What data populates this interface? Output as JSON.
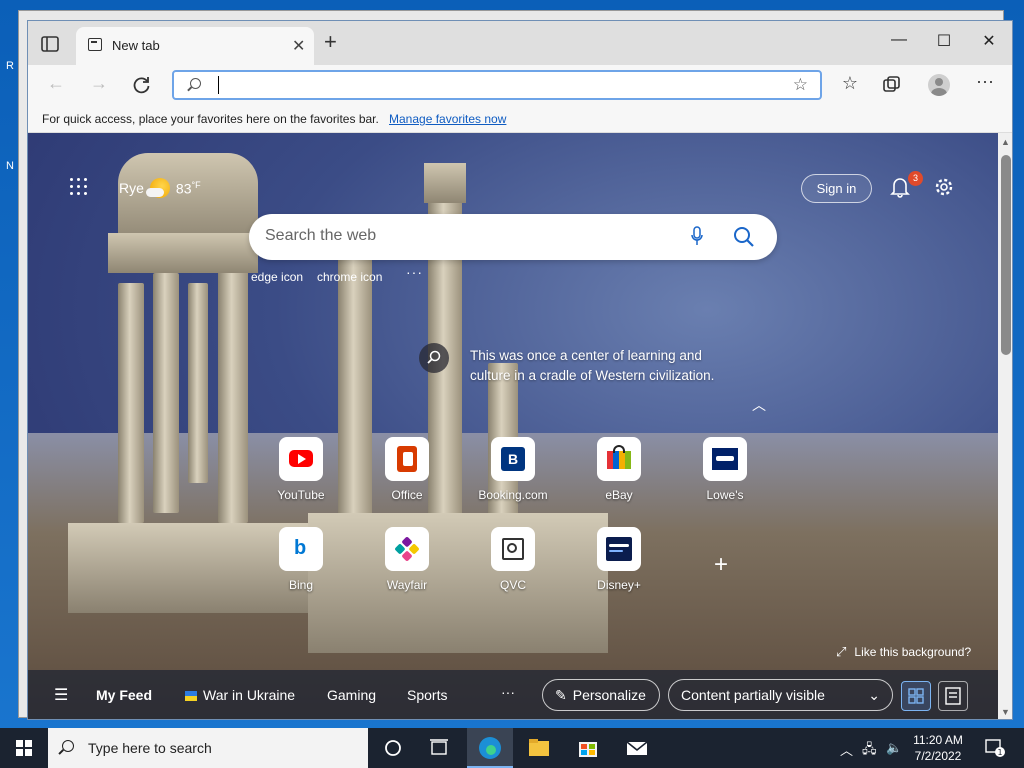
{
  "desktop_bits": [
    "R",
    "N"
  ],
  "tab": {
    "title": "New tab"
  },
  "favbar": {
    "message": "For quick access, place your favorites here on the favorites bar.",
    "link": "Manage favorites now"
  },
  "address": {
    "value": ""
  },
  "ntp": {
    "location": "Rye",
    "temperature": "83",
    "temp_unit": "°F",
    "signin_label": "Sign in",
    "notification_count": "3",
    "search_placeholder": "Search the web",
    "quick_links": [
      "edge icon",
      "chrome icon"
    ],
    "more": "···",
    "image_info": "This was once a center of learning and culture in a cradle of Western civilization.",
    "like_bg": "Like this background?"
  },
  "tiles": [
    {
      "label": "YouTube",
      "color": "#ff0000"
    },
    {
      "label": "Office",
      "color": "#d83b01"
    },
    {
      "label": "Booking.com",
      "color": "#003580"
    },
    {
      "label": "eBay",
      "color": "#e53238"
    },
    {
      "label": "Lowe's",
      "color": "#012169"
    },
    {
      "label": "Bing",
      "color": "#0078d4"
    },
    {
      "label": "Wayfair",
      "color": "#7b189f"
    },
    {
      "label": "QVC",
      "color": "#333333"
    },
    {
      "label": "Disney+",
      "color": "#0b1d4e"
    }
  ],
  "feed": {
    "my_feed": "My Feed",
    "items": [
      "War in Ukraine",
      "Gaming",
      "Sports"
    ],
    "more": "···",
    "personalize": "Personalize",
    "visibility": "Content partially visible"
  },
  "taskbar": {
    "search_placeholder": "Type here to search",
    "time": "11:20 AM",
    "date": "7/2/2022",
    "notif_count": "1"
  },
  "colors": {
    "accent": "#0f5cc2",
    "address_border": "#6ea4e8",
    "badge": "#e14a2b"
  }
}
